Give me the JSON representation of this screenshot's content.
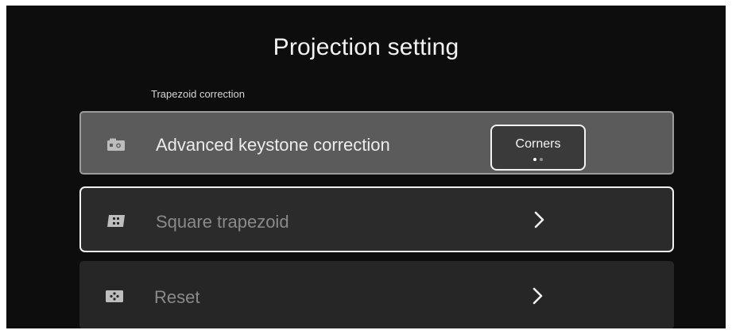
{
  "page": {
    "title": "Projection setting",
    "section_label": "Trapezoid correction"
  },
  "rows": [
    {
      "label": "Advanced keystone correction",
      "icon": "keystone-icon",
      "value": "Corners",
      "value_pages": 2,
      "value_page_active": 1,
      "state": "selected"
    },
    {
      "label": "Square trapezoid",
      "icon": "square-trapezoid-icon",
      "action_icon": "chevron-right-icon",
      "state": "focused"
    },
    {
      "label": "Reset",
      "icon": "reset-icon",
      "action_icon": "chevron-right-icon",
      "state": "normal"
    }
  ],
  "colors": {
    "background": "#0d0d0d",
    "row_selected": "#5b5b5b",
    "row_normal": "#2b2b2b",
    "focus_border": "#f1f1f1",
    "text_primary": "#ececec",
    "text_dimmed": "#8a8a8a"
  }
}
